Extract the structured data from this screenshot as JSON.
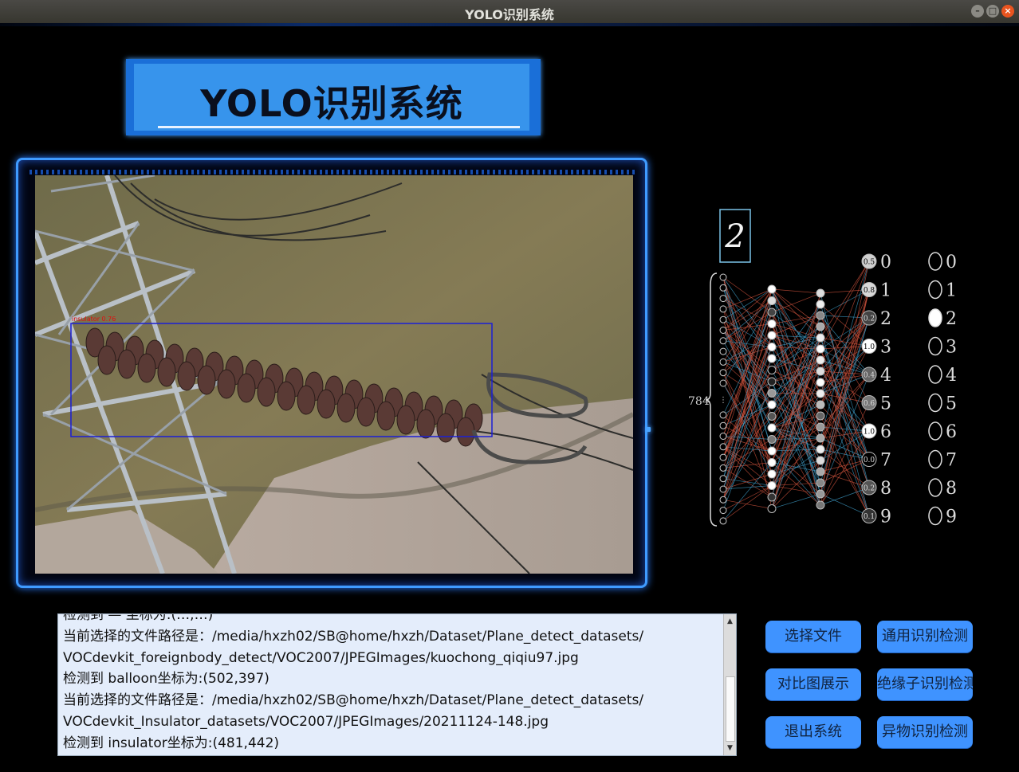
{
  "window": {
    "title": "YOLO识别系统",
    "controls": [
      "minimize",
      "maximize",
      "close"
    ]
  },
  "banner": {
    "title": "YOLO识别系统"
  },
  "detection": {
    "label": "insulator 0.76"
  },
  "nn_figure": {
    "input_count": "784",
    "digit": "2",
    "outputs": [
      "0.5",
      "0.8",
      "0.2",
      "1.0",
      "0.4",
      "0.6",
      "1.0",
      "0.0",
      "0.2",
      "0.1"
    ],
    "digits": [
      "0",
      "1",
      "2",
      "3",
      "4",
      "5",
      "6",
      "7",
      "8",
      "9"
    ]
  },
  "log": {
    "lines": [
      "检测到 — 坐标为:(…,…)",
      "当前选择的文件路径是：/media/hxzh02/SB@home/hxzh/Dataset/Plane_detect_datasets/",
      "VOCdevkit_foreignbody_detect/VOC2007/JPEGImages/kuochong_qiqiu97.jpg",
      "检测到 balloon坐标为:(502,397)",
      "当前选择的文件路径是：/media/hxzh02/SB@home/hxzh/Dataset/Plane_detect_datasets/",
      "VOCdevkit_Insulator_datasets/VOC2007/JPEGImages/20211124-148.jpg",
      "检测到 insulator坐标为:(481,442)"
    ]
  },
  "buttons": {
    "select_file": "选择文件",
    "general_detect": "通用识别检测",
    "compare": "对比图展示",
    "insulator_detect": "绝缘子识别检测",
    "exit": "退出系统",
    "foreign_detect": "异物识别检测"
  },
  "colors": {
    "accent": "#3f93ff",
    "banner": "#3794ec",
    "frame": "#3f9bff"
  }
}
